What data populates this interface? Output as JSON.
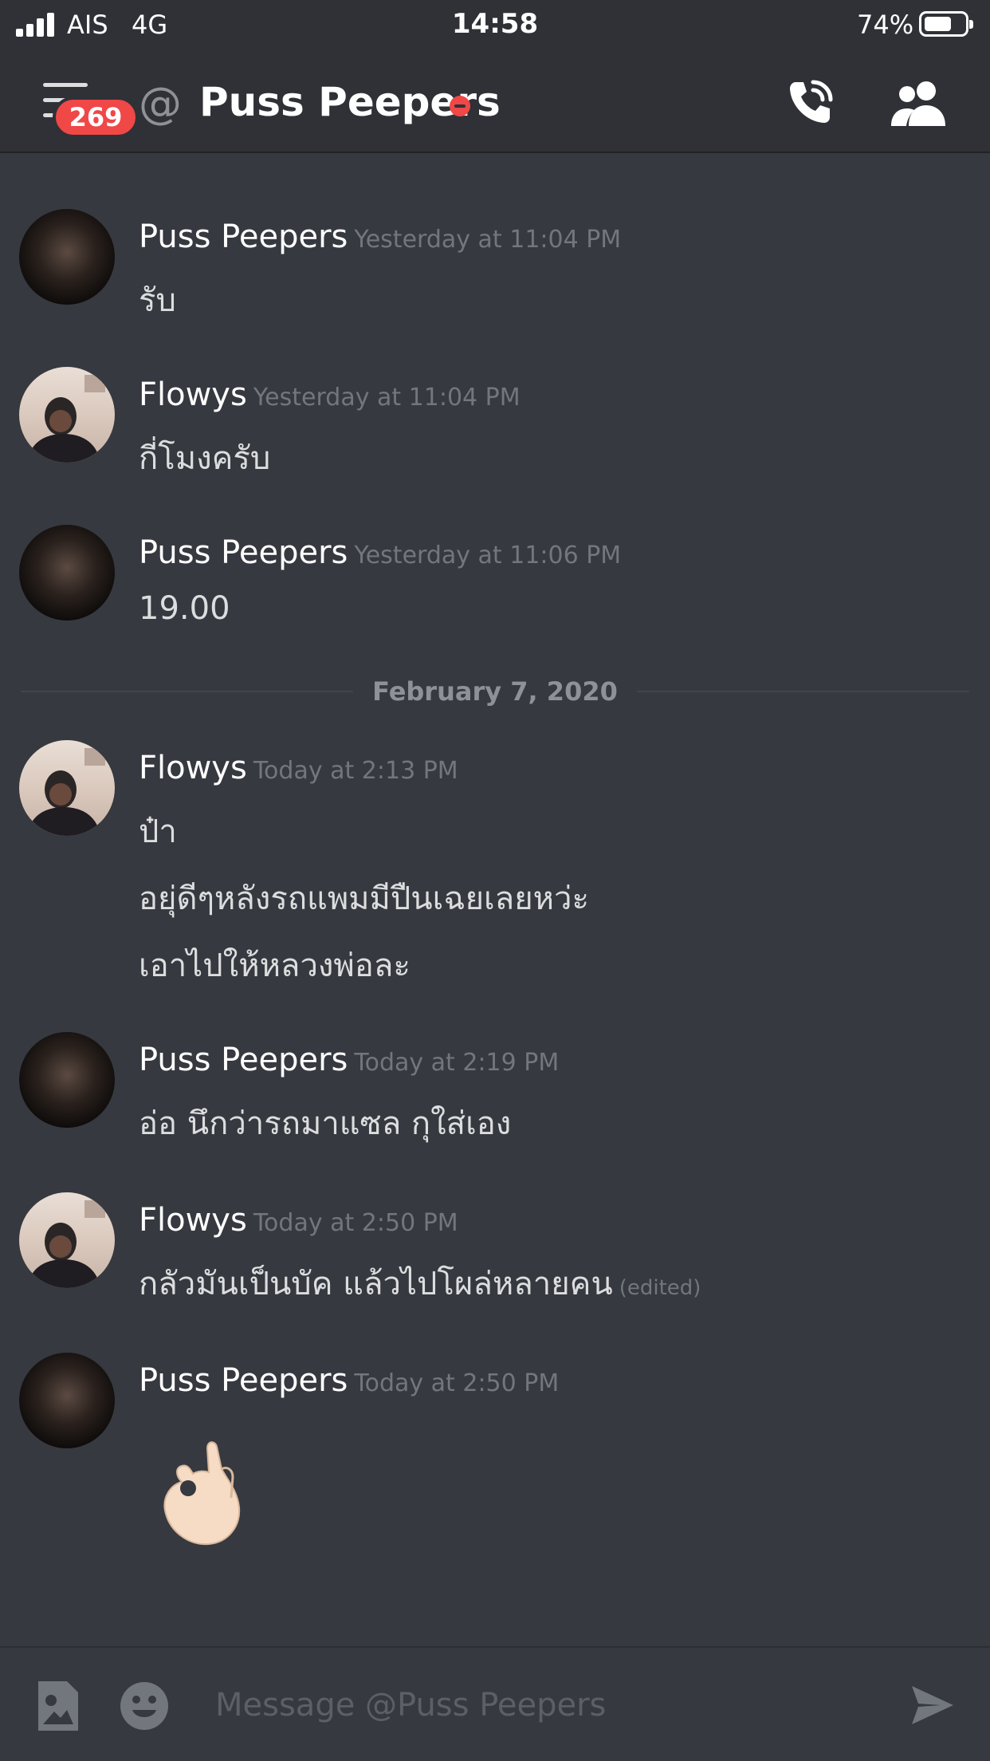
{
  "status_bar": {
    "carrier": "AIS",
    "network": "4G",
    "time": "14:58",
    "battery_percent": "74%",
    "battery_level": 0.74
  },
  "header": {
    "unread_badge": "269",
    "channel_name": "Puss Peepers",
    "status": "do-not-disturb",
    "status_color": "#f04747"
  },
  "messages": [
    {
      "author": "Puss Peepers",
      "timestamp": "Yesterday at 11:04 PM",
      "lines": [
        "รับ"
      ]
    },
    {
      "author": "Flowys",
      "timestamp": "Yesterday at 11:04 PM",
      "lines": [
        "กี่โมงครับ"
      ]
    },
    {
      "author": "Puss Peepers",
      "timestamp": "Yesterday at 11:06 PM",
      "lines": [
        "19.00"
      ]
    },
    {
      "author": "Flowys",
      "timestamp": "Today at 2:13 PM",
      "lines": [
        "ป๋า",
        "อยุ่ดีๆหลังรถแพมมีปืนเฉยเลยหว่ะ",
        "เอาไปให้หลวงพ่อละ"
      ]
    },
    {
      "author": "Puss Peepers",
      "timestamp": "Today at 2:19 PM",
      "lines": [
        "อ่อ นึกว่ารถมาแซล กุใส่เอง"
      ]
    },
    {
      "author": "Flowys",
      "timestamp": "Today at 2:50 PM",
      "lines": [
        "กลัวมันเป็นบัค แล้วไปโผล่หลายคน"
      ],
      "edited": "(edited)"
    },
    {
      "author": "Puss Peepers",
      "timestamp": "Today at 2:50 PM",
      "emoji": "ok-hand"
    }
  ],
  "date_divider": "February 7, 2020",
  "composer": {
    "placeholder": "Message @Puss Peepers"
  },
  "colors": {
    "background": "#36393f",
    "header": "#2f3136",
    "badge": "#f04747"
  }
}
